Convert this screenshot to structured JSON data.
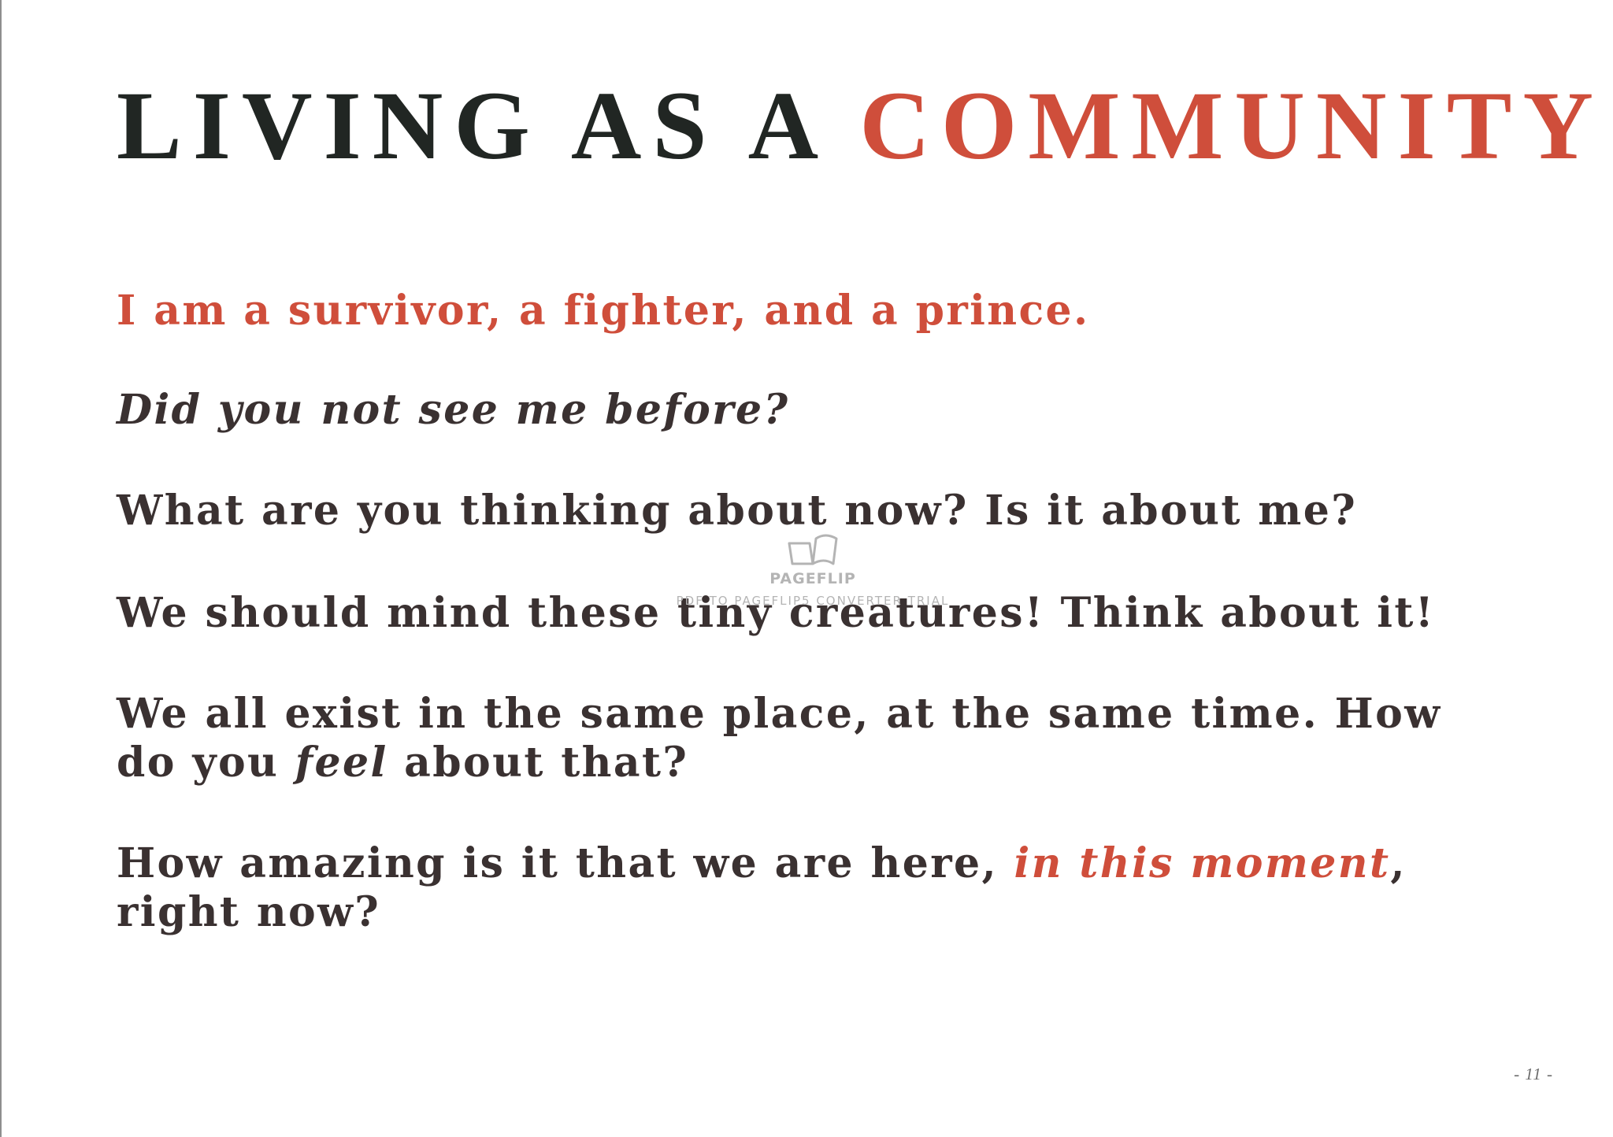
{
  "title": {
    "main": "LIVING AS A ",
    "accent": "COMMUNITY"
  },
  "colors": {
    "accent": "#cf4e3b",
    "heading": "#212623",
    "body": "#3a3131"
  },
  "paragraphs": {
    "p1": "I am a survivor, a fighter, and a prince.",
    "p2": "Did you not see me before?",
    "p3": "What are you thinking about now? Is it about me?",
    "p4": "We should mind these tiny creatures! Think about it!",
    "p5": {
      "before": "We all exist in the same place, at the same time. How do you ",
      "emphasis": "feel",
      "after": " about that?"
    },
    "p6": {
      "before": "How amazing is it that we are here, ",
      "emphasis": "in this moment",
      "after": ", right now?"
    }
  },
  "watermark": {
    "icon": "open-book-icon",
    "name": "PAGEFLIP",
    "subtitle": "PDF TO PAGEFLIP5 CONVERTER TRIAL"
  },
  "page_number": "- 11 -"
}
